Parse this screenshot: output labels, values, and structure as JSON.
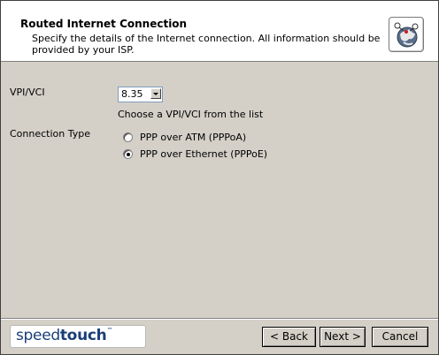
{
  "header": {
    "title": "Routed Internet Connection",
    "description": "Specify the details of the Internet connection. All information should be provided by your ISP.",
    "icon": "globe-icon"
  },
  "form": {
    "vpi_vci": {
      "label": "VPI/VCI",
      "selected": "8.35",
      "hint": "Choose a VPI/VCI from the list"
    },
    "connection_type": {
      "label": "Connection Type",
      "options": [
        {
          "label": "PPP over ATM (PPPoA)",
          "checked": false
        },
        {
          "label": "PPP over Ethernet (PPPoE)",
          "checked": true
        }
      ]
    }
  },
  "footer": {
    "logo": {
      "part1": "speed",
      "part2": "touch",
      "tm": "™"
    },
    "back_label": "< Back",
    "next_label": "Next >",
    "cancel_label": "Cancel"
  }
}
